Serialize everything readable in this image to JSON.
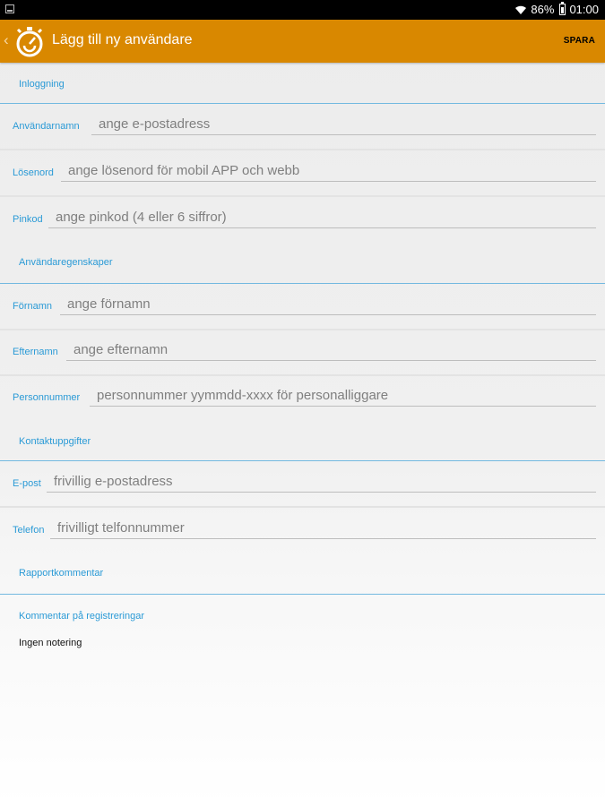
{
  "status_bar": {
    "battery_percent": "86%",
    "time": "01:00"
  },
  "app_bar": {
    "title": "Lägg till ny användare",
    "save_label": "SPARA",
    "logo_icon": "stopwatch-icon",
    "back_icon": "chevron-left-icon"
  },
  "colors": {
    "app_bar": "#d98800",
    "accent_label": "#2a9ad6",
    "divider": "#73b9e0"
  },
  "sections": {
    "login": "Inloggning",
    "user_props": "Användaregenskaper",
    "contact": "Kontaktuppgifter",
    "report": "Rapportkommentar"
  },
  "fields": {
    "username": {
      "label": "Användarnamn",
      "placeholder": "ange e-postadress"
    },
    "password": {
      "label": "Lösenord",
      "placeholder": "ange lösenord för mobil APP och webb"
    },
    "pin": {
      "label": "Pinkod",
      "placeholder": "ange pinkod (4 eller 6 siffror)"
    },
    "firstname": {
      "label": "Förnamn",
      "placeholder": "ange förnamn"
    },
    "lastname": {
      "label": "Efternamn",
      "placeholder": "ange efternamn"
    },
    "personal_number": {
      "label": "Personnummer",
      "placeholder": "personnummer yymmdd-xxxx för personalliggare"
    },
    "email": {
      "label": "E-post",
      "placeholder": "frivillig e-postadress"
    },
    "phone": {
      "label": "Telefon",
      "placeholder": "frivilligt telfonnummer"
    }
  },
  "report": {
    "comment_label": "Kommentar på registreringar",
    "comment_value": "Ingen notering"
  }
}
